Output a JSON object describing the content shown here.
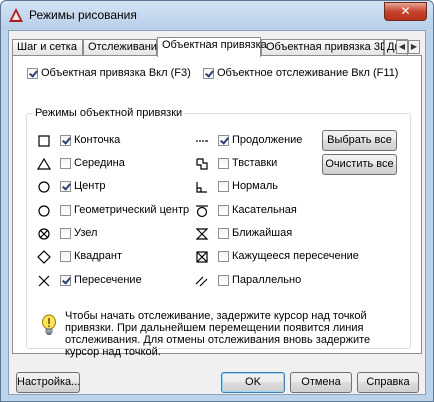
{
  "window": {
    "title": "Режимы рисования",
    "close_glyph": "✕"
  },
  "tabs": [
    {
      "label": "Шаг и сетка"
    },
    {
      "label": "Отслеживание"
    },
    {
      "label": "Объектная привязка"
    },
    {
      "label": "Объектная привязка 3D"
    },
    {
      "label": "Дин"
    }
  ],
  "tab_scroll": {
    "left": "◀",
    "right": "▶"
  },
  "top_options": {
    "osnap_on": {
      "label": "Объектная привязка Вкл (F3)",
      "checked": true
    },
    "otrack_on": {
      "label": "Объектное отслеживание Вкл (F11)",
      "checked": true
    }
  },
  "group": {
    "title": "Режимы объектной привязки",
    "left_modes": [
      {
        "label": "Конточка",
        "checked": true,
        "icon": "square-icon"
      },
      {
        "label": "Середина",
        "checked": false,
        "icon": "triangle-icon"
      },
      {
        "label": "Центр",
        "checked": true,
        "icon": "circle-icon"
      },
      {
        "label": "Геометрический центр",
        "checked": false,
        "icon": "circle-icon"
      },
      {
        "label": "Узел",
        "checked": false,
        "icon": "node-icon"
      },
      {
        "label": "Квадрант",
        "checked": false,
        "icon": "diamond-icon"
      },
      {
        "label": "Пересечение",
        "checked": true,
        "icon": "cross-icon"
      }
    ],
    "right_modes": [
      {
        "label": "Продолжение",
        "checked": true,
        "icon": "extension-icon"
      },
      {
        "label": "Твставки",
        "checked": false,
        "icon": "insert-icon"
      },
      {
        "label": "Нормаль",
        "checked": false,
        "icon": "perpendicular-icon"
      },
      {
        "label": "Касательная",
        "checked": false,
        "icon": "tangent-icon"
      },
      {
        "label": "Ближайшая",
        "checked": false,
        "icon": "nearest-icon"
      },
      {
        "label": "Кажущееся пересечение",
        "checked": false,
        "icon": "apparent-intersection-icon"
      },
      {
        "label": "Параллельно",
        "checked": false,
        "icon": "parallel-icon"
      }
    ],
    "select_all": "Выбрать все",
    "clear_all": "Очистить все",
    "info_text": "Чтобы начать отслеживание, задержите курсор над точкой привязки. При дальнейшем перемещении появится линия отслеживания. Для отмены отслеживания вновь задержите курсор над точкой."
  },
  "footer": {
    "settings": "Настройка...",
    "ok": "OK",
    "cancel": "Отмена",
    "help": "Справка"
  }
}
